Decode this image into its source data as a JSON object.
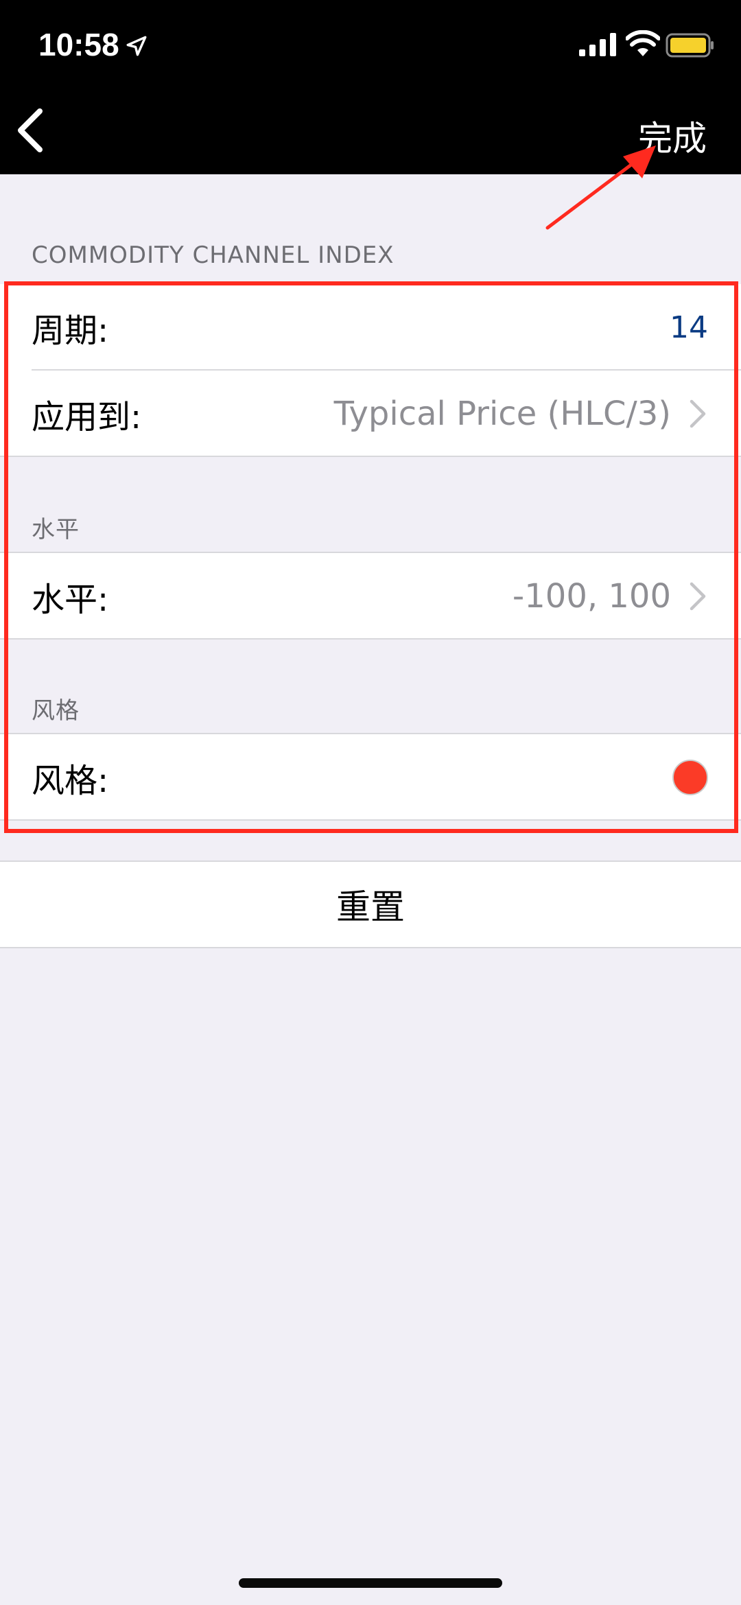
{
  "status_bar": {
    "time": "10:58"
  },
  "nav": {
    "done_label": "完成"
  },
  "sections": [
    {
      "header": "COMMODITY CHANNEL INDEX",
      "rows": [
        {
          "label": "周期:",
          "value": "14"
        },
        {
          "label": "应用到:",
          "value": "Typical Price (HLC/3)"
        }
      ]
    },
    {
      "header": "水平",
      "rows": [
        {
          "label": "水平:",
          "value": "-100, 100"
        }
      ]
    },
    {
      "header": "风格",
      "rows": [
        {
          "label": "风格:",
          "color": "#fb3b27"
        }
      ]
    }
  ],
  "reset_label": "重置",
  "colors": {
    "annotation": "#ff2a1f",
    "period_value": "#0b3b83",
    "background": "#f1eff6",
    "battery": "#f6d12c"
  },
  "icons": [
    "location-arrow-icon",
    "signal-bars-icon",
    "wifi-icon",
    "battery-icon",
    "back-chevron-icon",
    "chevron-right-icon"
  ]
}
